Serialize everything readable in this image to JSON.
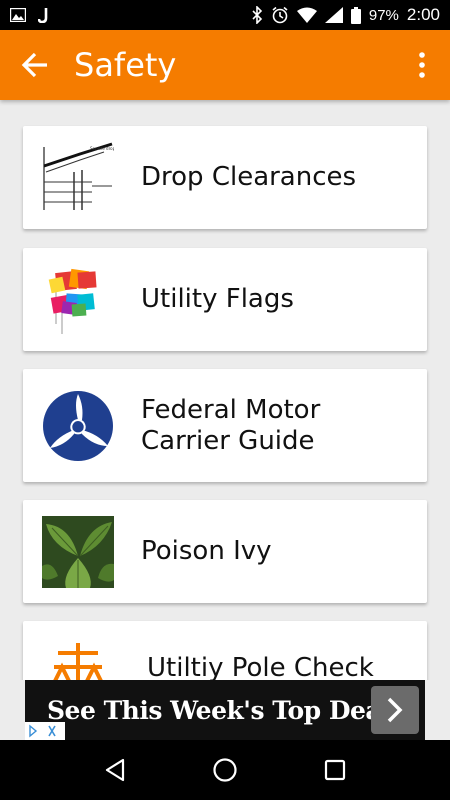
{
  "status_bar": {
    "battery": "97%",
    "time": "2:00",
    "icons": [
      "image-icon",
      "j-icon",
      "bluetooth-icon",
      "alarm-icon",
      "wifi-icon",
      "signal-icon",
      "battery-icon"
    ]
  },
  "app_bar": {
    "title": "Safety",
    "accent_color": "#f57c00"
  },
  "items": [
    {
      "label": "Drop Clearances",
      "icon": "drop-clearances-diagram"
    },
    {
      "label": "Utility Flags",
      "icon": "utility-flags-image"
    },
    {
      "label_line1": "Federal Motor",
      "label_line2": "Carrier Guide",
      "icon": "fmcsa-logo"
    },
    {
      "label": "Poison Ivy",
      "icon": "poison-ivy-photo"
    },
    {
      "label": "Utiltiy Pole Check",
      "icon": "utility-pole-icon"
    }
  ],
  "ad": {
    "text": "See This Week's Top Deals"
  },
  "nav_bar": {
    "buttons": [
      "back-triangle-icon",
      "home-circle-icon",
      "recents-square-icon"
    ]
  }
}
